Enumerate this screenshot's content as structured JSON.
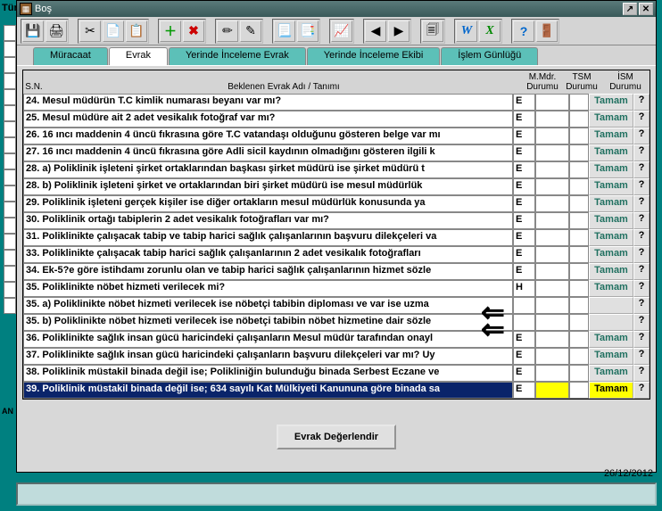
{
  "outer_label": "Tür:",
  "au_label": "AN",
  "window": {
    "title": "Boş"
  },
  "tabs": [
    {
      "id": "muracaat",
      "label": "Müracaat"
    },
    {
      "id": "evrak",
      "label": "Evrak"
    },
    {
      "id": "yerinde-evrak",
      "label": "Yerinde İnceleme Evrak"
    },
    {
      "id": "yerinde-ekibi",
      "label": "Yerinde İnceleme Ekibi"
    },
    {
      "id": "islem",
      "label": "İşlem Günlüğü"
    }
  ],
  "grid": {
    "headers": {
      "sn": "S.N.",
      "desc": "Beklenen Evrak Adı / Tanımı",
      "s1": "M.Mdr. Durumu",
      "s2": "TSM Durumu",
      "s3": "İSM Durumu"
    },
    "rows": [
      {
        "desc": "24. Mesul müdürün T.C kimlik numarası beyanı var mı?",
        "s1": "E",
        "s2": "",
        "action": "Tamam",
        "selected": false
      },
      {
        "desc": "25. Mesul müdüre ait 2 adet vesikalık fotoğraf var mı?",
        "s1": "E",
        "s2": "",
        "action": "Tamam",
        "selected": false
      },
      {
        "desc": "26. 16 ıncı maddenin 4 üncü fıkrasına göre T.C vatandaşı olduğunu gösteren belge var mı",
        "s1": "E",
        "s2": "",
        "action": "Tamam",
        "selected": false
      },
      {
        "desc": "27. 16 ıncı maddenin 4 üncü fıkrasına göre Adli sicil kaydının olmadığını gösteren ilgili k",
        "s1": "E",
        "s2": "",
        "action": "Tamam",
        "selected": false
      },
      {
        "desc": "28. a) Poliklinik işleteni şirket ortaklarından başkası şirket müdürü ise şirket müdürü t",
        "s1": "E",
        "s2": "",
        "action": "Tamam",
        "selected": false
      },
      {
        "desc": "28. b) Poliklinik işleteni şirket ve ortaklarından biri şirket müdürü ise mesul müdürlük",
        "s1": "E",
        "s2": "",
        "action": "Tamam",
        "selected": false
      },
      {
        "desc": "29. Poliklinik işleteni gerçek kişiler ise diğer ortakların mesul müdürlük konusunda ya",
        "s1": "E",
        "s2": "",
        "action": "Tamam",
        "selected": false
      },
      {
        "desc": "30. Poliklinik ortağı tabiplerin 2 adet vesikalık fotoğrafları var mı?",
        "s1": "E",
        "s2": "",
        "action": "Tamam",
        "selected": false
      },
      {
        "desc": "31. Poliklinikte çalışacak tabip ve tabip harici sağlık çalışanlarının başvuru dilekçeleri va",
        "s1": "E",
        "s2": "",
        "action": "Tamam",
        "selected": false
      },
      {
        "desc": "33. Poliklinikte çalışacak tabip harici sağlık çalışanlarının 2 adet vesikalık fotoğrafları",
        "s1": "E",
        "s2": "",
        "action": "Tamam",
        "selected": false
      },
      {
        "desc": "34. Ek-5?e göre istihdamı zorunlu olan ve tabip harici sağlık çalışanlarının hizmet sözle",
        "s1": "E",
        "s2": "",
        "action": "Tamam",
        "selected": false
      },
      {
        "desc": "35. Poliklinikte nöbet hizmeti verilecek mi?",
        "s1": "H",
        "s2": "",
        "action": "Tamam",
        "selected": false
      },
      {
        "desc": "35. a) Poliklinikte nöbet hizmeti verilecek ise nöbetçi tabibin diploması ve var ise uzma",
        "s1": "",
        "s2": "",
        "action": "",
        "selected": false,
        "arrow": true
      },
      {
        "desc": "35. b) Poliklinikte nöbet hizmeti verilecek ise nöbetçi tabibin nöbet hizmetine dair sözle",
        "s1": "",
        "s2": "",
        "action": "",
        "selected": false,
        "arrow": true
      },
      {
        "desc": "36. Poliklinikte sağlık insan gücü haricindeki çalışanların Mesul müdür tarafından onayl",
        "s1": "E",
        "s2": "",
        "action": "Tamam",
        "selected": false
      },
      {
        "desc": "37. Poliklinikte sağlık insan gücü haricindeki çalışanların başvuru dilekçeleri var mı? Uy",
        "s1": "E",
        "s2": "",
        "action": "Tamam",
        "selected": false
      },
      {
        "desc": "38. Poliklinik müstakil binada değil ise; Polikliniğin bulunduğu binada Serbest Eczane ve",
        "s1": "E",
        "s2": "",
        "action": "Tamam",
        "selected": false
      },
      {
        "desc": "39. Poliklinik müstakil binada değil ise; 634 sayılı Kat Mülkiyeti Kanununa göre binada sa",
        "s1": "E",
        "s2": "",
        "action": "Tamam",
        "selected": true
      }
    ],
    "question_label": "?"
  },
  "eval_button": "Evrak Değerlendir",
  "date": "26/12/2012"
}
